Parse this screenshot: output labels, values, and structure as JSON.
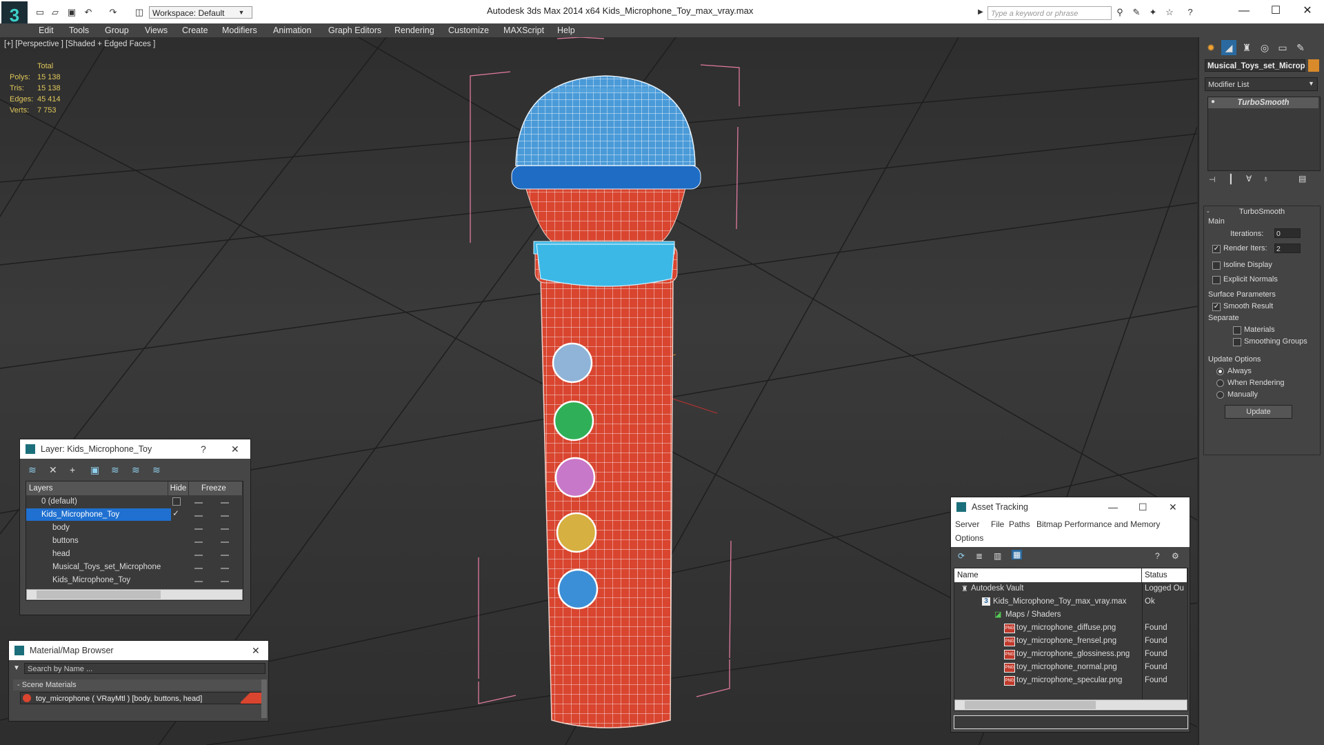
{
  "app": {
    "title": "Autodesk 3ds Max  2014 x64      Kids_Microphone_Toy_max_vray.max",
    "workspace": "Workspace: Default",
    "search_placeholder": "Type a keyword or phrase"
  },
  "menu": [
    "Edit",
    "Tools",
    "Group",
    "Views",
    "Create",
    "Modifiers",
    "Animation",
    "Graph Editors",
    "Rendering",
    "Customize",
    "MAXScript",
    "Help"
  ],
  "viewport": {
    "label": "[+] [Perspective ] [Shaded + Edged Faces ]",
    "stats": {
      "header": "Total",
      "polys_label": "Polys:",
      "polys": "15 138",
      "tris_label": "Tris:",
      "tris": "15 138",
      "edges_label": "Edges:",
      "edges": "45 414",
      "verts_label": "Verts:",
      "verts": "7 753"
    }
  },
  "command_panel": {
    "object_name": "Musical_Toys_set_Microphone",
    "object_color": "#d98a2b",
    "modifier_list": "Modifier List",
    "stack_item": "TurboSmooth",
    "rollout_title": "TurboSmooth",
    "main_label": "Main",
    "iterations_label": "Iterations:",
    "iterations": "0",
    "render_iters_label": "Render Iters:",
    "render_iters": "2",
    "render_iters_checked": true,
    "isoline_label": "Isoline Display",
    "explicit_normals_label": "Explicit Normals",
    "surface_params_label": "Surface Parameters",
    "smooth_result_label": "Smooth Result",
    "separate_label": "Separate",
    "materials_label": "Materials",
    "smoothing_groups_label": "Smoothing Groups",
    "update_options_label": "Update Options",
    "always_label": "Always",
    "when_rendering_label": "When Rendering",
    "manually_label": "Manually",
    "update_button": "Update"
  },
  "layer_window": {
    "title": "Layer: Kids_Microphone_Toy",
    "help": "?",
    "col_layers": "Layers",
    "col_hide": "Hide",
    "col_freeze": "Freeze",
    "rows": [
      {
        "name": "0 (default)"
      },
      {
        "name": "Kids_Microphone_Toy"
      },
      {
        "name": "body"
      },
      {
        "name": "buttons"
      },
      {
        "name": "head"
      },
      {
        "name": "Musical_Toys_set_Microphone"
      },
      {
        "name": "Kids_Microphone_Toy"
      }
    ]
  },
  "material_browser": {
    "title": "Material/Map Browser",
    "search_placeholder": "Search by Name ...",
    "section": "Scene Materials",
    "material": "toy_microphone  ( VRayMtl ) [body, buttons, head]"
  },
  "asset_tracking": {
    "title": "Asset Tracking",
    "menu": [
      "Server",
      "File",
      "Paths",
      "Bitmap Performance and Memory"
    ],
    "menu2": "Options",
    "col_name": "Name",
    "col_status": "Status",
    "rows": [
      {
        "name": "Autodesk Vault",
        "status": "Logged Ou"
      },
      {
        "name": "Kids_Microphone_Toy_max_vray.max",
        "status": "Ok"
      },
      {
        "name": "Maps / Shaders",
        "status": ""
      },
      {
        "name": "toy_microphone_diffuse.png",
        "status": "Found"
      },
      {
        "name": "toy_microphone_frensel.png",
        "status": "Found"
      },
      {
        "name": "toy_microphone_glossiness.png",
        "status": "Found"
      },
      {
        "name": "toy_microphone_normal.png",
        "status": "Found"
      },
      {
        "name": "toy_microphone_specular.png",
        "status": "Found"
      }
    ]
  },
  "colors": {
    "body_red": "#d9452f",
    "head_blue": "#4a9ad8",
    "ring_cyan": "#3cb8e6",
    "button_colors": [
      "#8fb4d8",
      "#2fb058",
      "#c878c8",
      "#d6b040",
      "#3b8fd6"
    ]
  }
}
